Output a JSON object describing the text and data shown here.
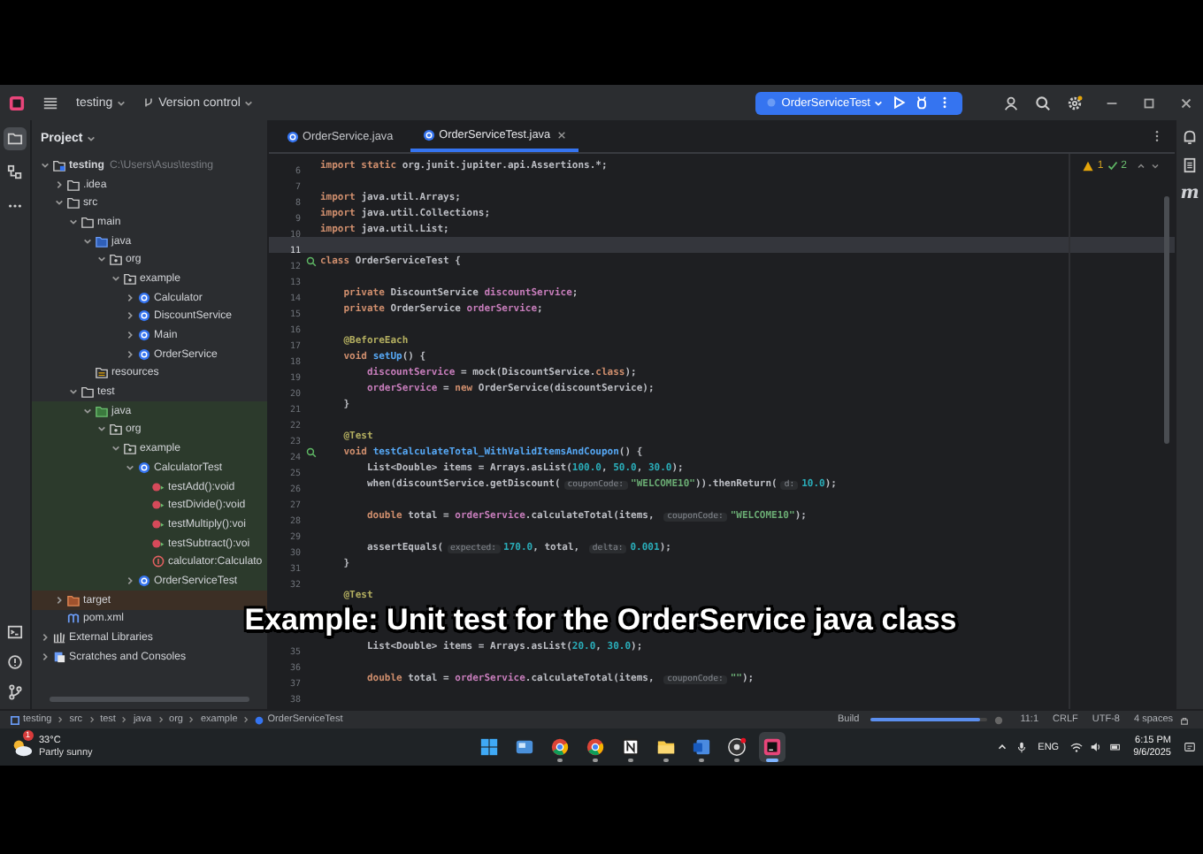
{
  "title_bar": {
    "project": "testing",
    "vcs": "Version control",
    "run_config": "OrderServiceTest"
  },
  "left_strip": {
    "top": [
      {
        "kind": "project",
        "selected": true
      },
      {
        "kind": "structure",
        "selected": false
      },
      {
        "kind": "more",
        "selected": false
      }
    ],
    "bottom": [
      {
        "kind": "terminal"
      },
      {
        "kind": "problems"
      },
      {
        "kind": "git"
      }
    ]
  },
  "project_panel": {
    "title": "Project",
    "tree": [
      {
        "label": "testing",
        "path": "C:\\Users\\Asus\\testing",
        "kind": "module",
        "expanded": true,
        "children": [
          {
            "label": ".idea",
            "kind": "folder",
            "expanded": false
          },
          {
            "label": "src",
            "kind": "folder",
            "expanded": true,
            "children": [
              {
                "label": "main",
                "kind": "folder",
                "expanded": true,
                "children": [
                  {
                    "label": "java",
                    "kind": "source-root",
                    "expanded": true,
                    "children": [
                      {
                        "label": "org",
                        "kind": "package",
                        "expanded": true,
                        "children": [
                          {
                            "label": "example",
                            "kind": "package",
                            "expanded": true,
                            "children": [
                              {
                                "label": "Calculator",
                                "kind": "class",
                                "expanded": false
                              },
                              {
                                "label": "DiscountService",
                                "kind": "class",
                                "expanded": false
                              },
                              {
                                "label": "Main",
                                "kind": "class",
                                "expanded": false
                              },
                              {
                                "label": "OrderService",
                                "kind": "class",
                                "expanded": false
                              }
                            ]
                          }
                        ]
                      }
                    ]
                  },
                  {
                    "label": "resources",
                    "kind": "resources-root"
                  }
                ]
              },
              {
                "label": "test",
                "kind": "folder",
                "expanded": true,
                "children": [
                  {
                    "label": "java",
                    "kind": "test-root",
                    "expanded": true,
                    "test_source": true,
                    "children": [
                      {
                        "label": "org",
                        "kind": "package",
                        "expanded": true,
                        "test_source": true,
                        "children": [
                          {
                            "label": "example",
                            "kind": "package",
                            "expanded": true,
                            "test_source": true,
                            "children": [
                              {
                                "label": "CalculatorTest",
                                "kind": "class",
                                "expanded": true,
                                "test_source": true,
                                "children": [
                                  {
                                    "label": "testAdd():void",
                                    "kind": "method",
                                    "test_source": true
                                  },
                                  {
                                    "label": "testDivide():void",
                                    "kind": "method",
                                    "test_source": true
                                  },
                                  {
                                    "label": "testMultiply():voi",
                                    "kind": "method",
                                    "test_source": true
                                  },
                                  {
                                    "label": "testSubtract():voi",
                                    "kind": "method",
                                    "test_source": true
                                  },
                                  {
                                    "label": "calculator:Calculato",
                                    "kind": "field",
                                    "test_source": true
                                  }
                                ]
                              },
                              {
                                "label": "OrderServiceTest",
                                "kind": "class",
                                "expanded": false,
                                "test_source": true
                              }
                            ]
                          }
                        ]
                      }
                    ]
                  }
                ]
              }
            ]
          },
          {
            "label": "target",
            "kind": "excluded-folder",
            "expanded": false,
            "excluded": true
          },
          {
            "label": "pom.xml",
            "kind": "maven"
          }
        ]
      },
      {
        "label": "External Libraries",
        "kind": "libraries",
        "expanded": false
      },
      {
        "label": "Scratches and Consoles",
        "kind": "scratches",
        "expanded": false
      }
    ]
  },
  "editor": {
    "tabs": [
      {
        "label": "OrderService.java",
        "selected": false
      },
      {
        "label": "OrderServiceTest.java",
        "selected": true
      }
    ],
    "warnings": "1",
    "passed": "2",
    "lines": [
      {
        "n": "6",
        "current": false,
        "run": false,
        "tokens": [
          {
            "text": "import static ",
            "kind": "kw"
          },
          {
            "text": "org.junit.jupiter.api.Assertions.*;",
            "kind": "plain"
          }
        ]
      },
      {
        "n": "7",
        "current": false,
        "run": false
      },
      {
        "n": "8",
        "current": false,
        "run": false,
        "tokens": [
          {
            "text": "import ",
            "kind": "kw"
          },
          {
            "text": "java.util.Arrays;",
            "kind": "plain"
          }
        ]
      },
      {
        "n": "9",
        "current": false,
        "run": false,
        "tokens": [
          {
            "text": "import ",
            "kind": "kw"
          },
          {
            "text": "java.util.Collections;",
            "kind": "plain"
          }
        ]
      },
      {
        "n": "10",
        "current": false,
        "run": false,
        "tokens": [
          {
            "text": "import ",
            "kind": "kw"
          },
          {
            "text": "java.util.List;",
            "kind": "plain"
          }
        ]
      },
      {
        "n": "11",
        "current": true,
        "run": false
      },
      {
        "n": "12",
        "current": false,
        "run": true,
        "tokens": [
          {
            "text": "class ",
            "kind": "kw"
          },
          {
            "text": "OrderServiceTest {",
            "kind": "plain"
          }
        ]
      },
      {
        "n": "13",
        "current": false,
        "run": false
      },
      {
        "n": "14",
        "current": false,
        "run": false,
        "tokens": [
          {
            "text": "    private ",
            "kind": "kw"
          },
          {
            "text": "DiscountService ",
            "kind": "plain"
          },
          {
            "text": "discountService",
            "kind": "field"
          },
          {
            "text": ";",
            "kind": "plain"
          }
        ]
      },
      {
        "n": "15",
        "current": false,
        "run": false,
        "tokens": [
          {
            "text": "    private ",
            "kind": "kw"
          },
          {
            "text": "OrderService ",
            "kind": "plain"
          },
          {
            "text": "orderService",
            "kind": "field"
          },
          {
            "text": ";",
            "kind": "plain"
          }
        ]
      },
      {
        "n": "16",
        "current": false,
        "run": false
      },
      {
        "n": "17",
        "current": false,
        "run": false,
        "tokens": [
          {
            "text": "    @BeforeEach",
            "kind": "ann"
          }
        ]
      },
      {
        "n": "18",
        "current": false,
        "run": false,
        "tokens": [
          {
            "text": "    void ",
            "kind": "kw"
          },
          {
            "text": "setUp",
            "kind": "method"
          },
          {
            "text": "() {",
            "kind": "plain"
          }
        ]
      },
      {
        "n": "19",
        "current": false,
        "run": false,
        "tokens": [
          {
            "text": "        discountService",
            "kind": "field"
          },
          {
            "text": " = mock(DiscountService.",
            "kind": "plain"
          },
          {
            "text": "class",
            "kind": "kw"
          },
          {
            "text": ");",
            "kind": "plain"
          }
        ]
      },
      {
        "n": "20",
        "current": false,
        "run": false,
        "tokens": [
          {
            "text": "        orderService",
            "kind": "field"
          },
          {
            "text": " = ",
            "kind": "plain"
          },
          {
            "text": "new ",
            "kind": "kw"
          },
          {
            "text": "OrderService(discountService);",
            "kind": "plain"
          }
        ]
      },
      {
        "n": "21",
        "current": false,
        "run": false,
        "tokens": [
          {
            "text": "    }",
            "kind": "plain"
          }
        ]
      },
      {
        "n": "22",
        "current": false,
        "run": false
      },
      {
        "n": "23",
        "current": false,
        "run": false,
        "tokens": [
          {
            "text": "    @Test",
            "kind": "ann"
          }
        ]
      },
      {
        "n": "24",
        "current": false,
        "run": true,
        "tokens": [
          {
            "text": "    void ",
            "kind": "kw"
          },
          {
            "text": "testCalculateTotal_WithValidItemsAndCoupon",
            "kind": "method"
          },
          {
            "text": "() {",
            "kind": "plain"
          }
        ]
      },
      {
        "n": "25",
        "current": false,
        "run": false,
        "tokens": [
          {
            "text": "        List<Double> items = Arrays.asList(",
            "kind": "plain"
          },
          {
            "text": "100.0",
            "kind": "num"
          },
          {
            "text": ", ",
            "kind": "plain"
          },
          {
            "text": "50.0",
            "kind": "num"
          },
          {
            "text": ", ",
            "kind": "plain"
          },
          {
            "text": "30.0",
            "kind": "num"
          },
          {
            "text": ");",
            "kind": "plain"
          }
        ]
      },
      {
        "n": "26",
        "current": false,
        "run": false,
        "tokens": [
          {
            "text": "        when(discountService.getDiscount(",
            "kind": "plain"
          },
          {
            "text": "couponCode:",
            "kind": "hint"
          },
          {
            "text": "\"WELCOME10\"",
            "kind": "str"
          },
          {
            "text": ")).thenReturn(",
            "kind": "plain"
          },
          {
            "text": "d:",
            "kind": "hint"
          },
          {
            "text": "10.0",
            "kind": "num"
          },
          {
            "text": ");",
            "kind": "plain"
          }
        ]
      },
      {
        "n": "27",
        "current": false,
        "run": false
      },
      {
        "n": "28",
        "current": false,
        "run": false,
        "tokens": [
          {
            "text": "        double ",
            "kind": "kw"
          },
          {
            "text": "total = ",
            "kind": "plain"
          },
          {
            "text": "orderService",
            "kind": "field"
          },
          {
            "text": ".calculateTotal(items, ",
            "kind": "plain"
          },
          {
            "text": "couponCode:",
            "kind": "hint"
          },
          {
            "text": "\"WELCOME10\"",
            "kind": "str"
          },
          {
            "text": ");",
            "kind": "plain"
          }
        ]
      },
      {
        "n": "29",
        "current": false,
        "run": false
      },
      {
        "n": "30",
        "current": false,
        "run": false,
        "tokens": [
          {
            "text": "        assertEquals(",
            "kind": "plain"
          },
          {
            "text": "expected:",
            "kind": "hint"
          },
          {
            "text": "170.0",
            "kind": "num"
          },
          {
            "text": ", total, ",
            "kind": "plain"
          },
          {
            "text": "delta:",
            "kind": "hint"
          },
          {
            "text": "0.001",
            "kind": "num"
          },
          {
            "text": ");",
            "kind": "plain"
          }
        ]
      },
      {
        "n": "31",
        "current": false,
        "run": false,
        "tokens": [
          {
            "text": "    }",
            "kind": "plain"
          }
        ]
      },
      {
        "n": "32",
        "current": false,
        "run": false
      },
      {
        "current": false,
        "run": false,
        "tokens": [
          {
            "text": "    @Test",
            "kind": "ann"
          }
        ]
      },
      {
        "caption": "Example: Unit test for the OrderService java class"
      },
      {
        "n": "35",
        "current": false,
        "run": false,
        "tokens": [
          {
            "text": "        List<Double> items = Arrays.asList(",
            "kind": "plain"
          },
          {
            "text": "20.0",
            "kind": "num"
          },
          {
            "text": ", ",
            "kind": "plain"
          },
          {
            "text": "30.0",
            "kind": "num"
          },
          {
            "text": ");",
            "kind": "plain"
          }
        ]
      },
      {
        "n": "36",
        "current": false,
        "run": false
      },
      {
        "n": "37",
        "current": false,
        "run": false,
        "tokens": [
          {
            "text": "        double ",
            "kind": "kw"
          },
          {
            "text": "total = ",
            "kind": "plain"
          },
          {
            "text": "orderService",
            "kind": "field"
          },
          {
            "text": ".calculateTotal(items, ",
            "kind": "plain"
          },
          {
            "text": "couponCode:",
            "kind": "hint"
          },
          {
            "text": "\"\"",
            "kind": "str"
          },
          {
            "text": ");",
            "kind": "plain"
          }
        ]
      },
      {
        "n": "38",
        "current": false,
        "run": false
      }
    ]
  },
  "right_strip": [
    {
      "kind": "bell"
    },
    {
      "kind": "document"
    },
    {
      "kind": "maven",
      "glyph": "m"
    }
  ],
  "status_bar": {
    "breadcrumbs": [
      "testing",
      "src",
      "test",
      "java",
      "org",
      "example",
      "OrderServiceTest"
    ],
    "build": {
      "label": "Build",
      "level": 0.95
    },
    "position": "11:1",
    "line_endings": "CRLF",
    "encoding": "UTF-8",
    "indent": "4 spaces"
  },
  "taskbar": {
    "weather": {
      "badge": "1",
      "temperature": "33°C",
      "condition": "Partly sunny"
    },
    "apps": [
      {
        "kind": "start",
        "running": false,
        "active": false
      },
      {
        "kind": "widgets",
        "running": false,
        "active": false
      },
      {
        "kind": "chrome",
        "running": true,
        "active": false
      },
      {
        "kind": "chrome",
        "running": true,
        "active": false
      },
      {
        "kind": "notion",
        "running": true,
        "active": false
      },
      {
        "kind": "explorer",
        "running": true,
        "active": false
      },
      {
        "kind": "word",
        "running": true,
        "active": false
      },
      {
        "kind": "obs",
        "running": true,
        "active": false
      },
      {
        "kind": "intellij",
        "running": true,
        "active": true
      }
    ],
    "language": "ENG",
    "time": "6:15 PM",
    "date": "9/6/2025"
  }
}
